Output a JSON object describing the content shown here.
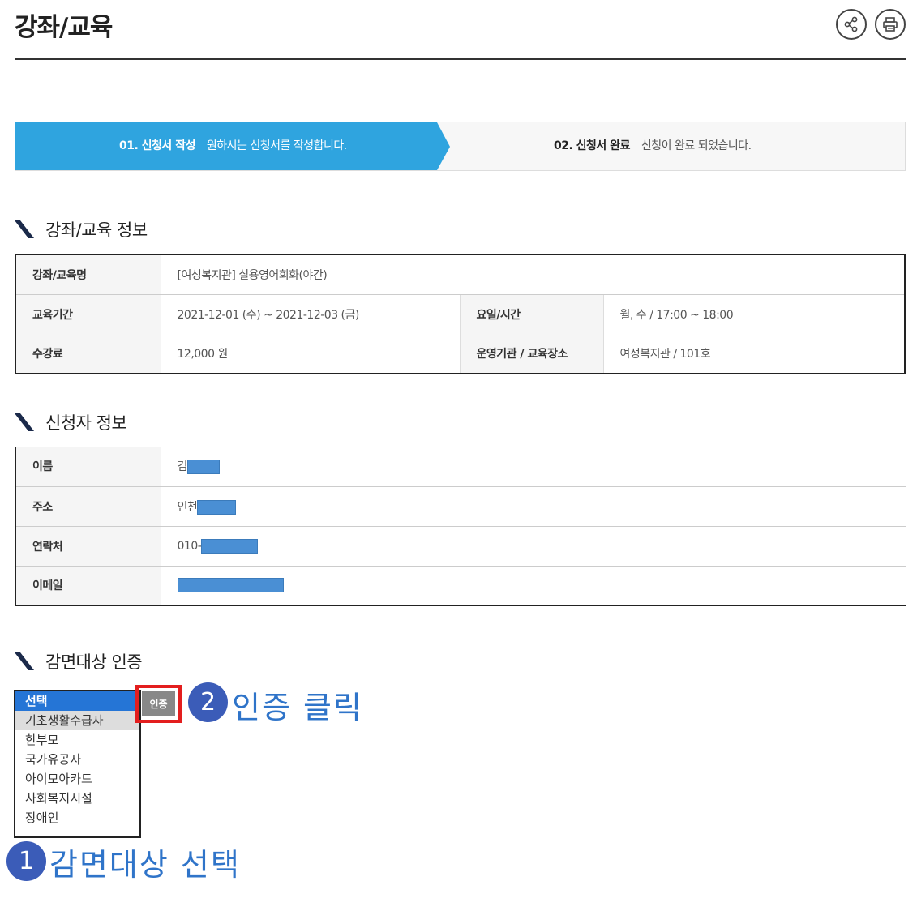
{
  "header": {
    "title": "강좌/교육",
    "share_icon": "share-icon",
    "print_icon": "print-icon"
  },
  "steps": [
    {
      "num": "01. 신청서 작성",
      "desc": "원하시는 신청서를 작성합니다."
    },
    {
      "num": "02. 신청서 완료",
      "desc": "신청이 완료 되었습니다."
    }
  ],
  "course_section": {
    "heading": "강좌/교육 정보",
    "name_label": "강좌/교육명",
    "name_value": "[여성복지관] 실용영어회화(야간)",
    "period_label": "교육기간",
    "period_value": "2021-12-01 (수) ~ 2021-12-03 (금)",
    "day_label": "요일/시간",
    "day_value": "월, 수 / 17:00 ~ 18:00",
    "fee_label": "수강료",
    "fee_value": "12,000 원",
    "org_label": "운영기관 / 교육장소",
    "org_value": "여성복지관 / 101호"
  },
  "applicant_section": {
    "heading": "신청자 정보",
    "name_label": "이름",
    "name_value": "김",
    "address_label": "주소",
    "address_value": "인천",
    "phone_label": "연락처",
    "phone_value": "010-",
    "email_label": "이메일",
    "email_value": ""
  },
  "discount_section": {
    "heading": "감면대상 인증",
    "options": [
      "선택",
      "기초생활수급자",
      "한부모",
      "국가유공자",
      "아이모아카드",
      "사회복지시설",
      "장애인"
    ],
    "auth_button": "인증"
  },
  "annotations": {
    "badge_1": "1",
    "callout_1": "감면대상 선택",
    "badge_2": "2",
    "callout_2": "인증 클릭"
  },
  "colors": {
    "step_active": "#2fa4df",
    "annotation_blue": "#2f74c9",
    "badge": "#3b5cb8",
    "highlight_red": "#e31e1e",
    "redaction": "#4a8fd4"
  }
}
